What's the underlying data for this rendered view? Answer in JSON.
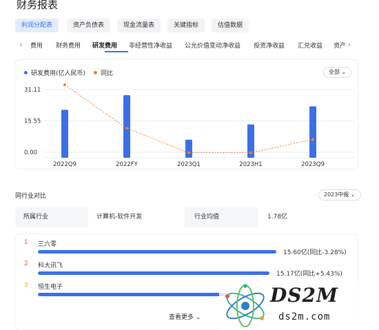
{
  "page": {
    "title": "财务报表"
  },
  "report_tabs": [
    {
      "label": "利润分配表",
      "active": true
    },
    {
      "label": "资产负债表",
      "active": false
    },
    {
      "label": "现金流量表",
      "active": false
    },
    {
      "label": "关键指标",
      "active": false
    },
    {
      "label": "估值数据",
      "active": false
    }
  ],
  "metric_tabs": [
    {
      "label": "费用",
      "active": false
    },
    {
      "label": "财务费用",
      "active": false
    },
    {
      "label": "研发费用",
      "active": true
    },
    {
      "label": "非经营性净收益",
      "active": false
    },
    {
      "label": "公允价值变动净收益",
      "active": false
    },
    {
      "label": "投资净收益",
      "active": false
    },
    {
      "label": "汇兑收益",
      "active": false
    },
    {
      "label": "资产",
      "active": false
    }
  ],
  "chart_card": {
    "legend": [
      "研发费用(亿人民币)",
      "同比"
    ],
    "dropdown": "全部"
  },
  "chart_data": {
    "type": "bar",
    "categories": [
      "2022Q9",
      "2022FY",
      "2023Q1",
      "2023H1",
      "2023Q9"
    ],
    "y_tick_labels": [
      "31.11",
      "15.55",
      "0.00"
    ],
    "series": [
      {
        "name": "研发费用(亿人民币)",
        "type": "bar",
        "values": [
          21.1,
          28.4,
          6.2,
          13.8,
          22.8
        ]
      },
      {
        "name": "同比",
        "type": "line",
        "values": [
          40.2,
          10.3,
          -6.5,
          -6.5,
          2.6
        ]
      }
    ],
    "ylim_bar": [
      -2.8,
      37.0
    ],
    "ylim_line": [
      -10,
      45
    ],
    "colors": {
      "bar": "#3a6fe8",
      "line": "#f07f2e",
      "grid": "#e9ecf0"
    }
  },
  "industry": {
    "title": "同行业对比",
    "dropdown": "2023中报",
    "label_industry": "所属行业",
    "industry_value": "计算机-软件开发",
    "label_avg": "行业均值",
    "avg_value": "1.78亿"
  },
  "ranking": [
    {
      "rank": "1",
      "name": "三六零",
      "value_text": "15.60亿(同比-3.28%)",
      "fraction": 1.0
    },
    {
      "rank": "2",
      "name": "科大讯飞",
      "value_text": "15.17亿(同比+5.43%)",
      "fraction": 0.97
    },
    {
      "rank": "3",
      "name": "恒生电子",
      "value_text": "",
      "fraction": 0.8
    }
  ],
  "more_label": "查看更多",
  "watermark": {
    "big": "DS2M",
    "small": "ds2m.com"
  }
}
